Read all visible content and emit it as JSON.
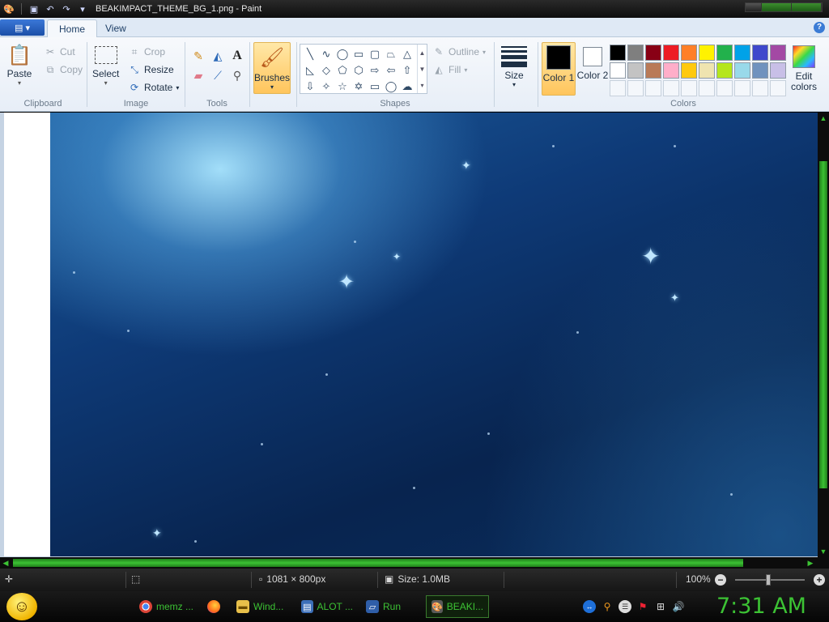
{
  "window": {
    "title": "BEAKIMPACT_THEME_BG_1.png - Paint"
  },
  "ribbon_tabs": {
    "home": "Home",
    "view": "View",
    "help": "?"
  },
  "clipboard": {
    "paste": "Paste",
    "cut": "Cut",
    "copy": "Copy",
    "label": "Clipboard"
  },
  "image_group": {
    "select": "Select",
    "crop": "Crop",
    "resize": "Resize",
    "rotate": "Rotate",
    "label": "Image"
  },
  "tools": {
    "label": "Tools",
    "text_tool": "A"
  },
  "brushes": {
    "label": "Brushes"
  },
  "shapes": {
    "outline": "Outline",
    "fill": "Fill",
    "label": "Shapes"
  },
  "size": {
    "label": "Size"
  },
  "colors": {
    "color1": "Color 1",
    "color2": "Color 2",
    "edit": "Edit colors",
    "label": "Colors",
    "color1_value": "#000000",
    "color2_value": "#ffffff",
    "palette_row1": [
      "#000000",
      "#7f7f7f",
      "#880015",
      "#ed1c24",
      "#ff7f27",
      "#fff200",
      "#22b14c",
      "#00a2e8",
      "#3f48cc",
      "#a349a4"
    ],
    "palette_row2": [
      "#ffffff",
      "#c3c3c3",
      "#b97a57",
      "#ffaec9",
      "#ffc90e",
      "#efe4b0",
      "#b5e61d",
      "#99d9ea",
      "#7092be",
      "#c8bfe7"
    ]
  },
  "status": {
    "dimensions": "1081 × 800px",
    "size": "Size: 1.0MB",
    "zoom": "100%"
  },
  "taskbar": {
    "items": [
      {
        "label": "memz ...",
        "icon": "chrome-icon"
      },
      {
        "label": "",
        "icon": "firefox-icon"
      },
      {
        "label": "Wind...",
        "icon": "folder-icon"
      },
      {
        "label": "ALOT ...",
        "icon": "window-icon"
      },
      {
        "label": "Run",
        "icon": "run-icon"
      },
      {
        "label": "BEAKI...",
        "icon": "paint-icon"
      }
    ],
    "clock": "7:31 AM"
  }
}
